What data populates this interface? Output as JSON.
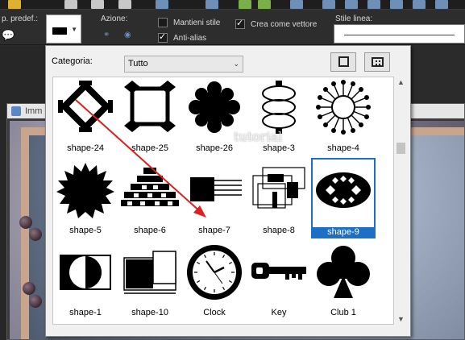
{
  "toolbar": {
    "preset_label": "p. predef.:",
    "action_label": "Azione:",
    "keep_style_label": "Mantieni stile",
    "keep_style_checked": false,
    "antialias_label": "Anti-alias",
    "antialias_checked": true,
    "vector_label": "Crea come vettore",
    "vector_checked": true,
    "line_style_label": "Stile linea:"
  },
  "photo_window": {
    "title": "Imm"
  },
  "picker": {
    "category_label": "Categoria:",
    "category_value": "Tutto",
    "shapes": [
      {
        "label": "shape-24",
        "icon": "shape-24-icon"
      },
      {
        "label": "shape-25",
        "icon": "shape-25-icon"
      },
      {
        "label": "shape-26",
        "icon": "shape-26-icon"
      },
      {
        "label": "shape-3",
        "icon": "shape-3-icon"
      },
      {
        "label": "shape-4",
        "icon": "shape-4-icon"
      },
      {
        "label": "shape-5",
        "icon": "shape-5-icon"
      },
      {
        "label": "shape-6",
        "icon": "shape-6-icon"
      },
      {
        "label": "shape-7",
        "icon": "shape-7-icon"
      },
      {
        "label": "shape-8",
        "icon": "shape-8-icon"
      },
      {
        "label": "shape-9",
        "icon": "shape-9-icon",
        "selected": true
      },
      {
        "label": "shape-1",
        "icon": "shape-1-icon"
      },
      {
        "label": "shape-10",
        "icon": "shape-10-icon"
      },
      {
        "label": "Clock",
        "icon": "clock-icon"
      },
      {
        "label": "Key",
        "icon": "key-icon"
      },
      {
        "label": "Club 1",
        "icon": "club-icon"
      }
    ]
  },
  "watermark": "tutorial",
  "colors": {
    "selection": "#1c6fc5",
    "annotation_arrow": "#e02020"
  }
}
